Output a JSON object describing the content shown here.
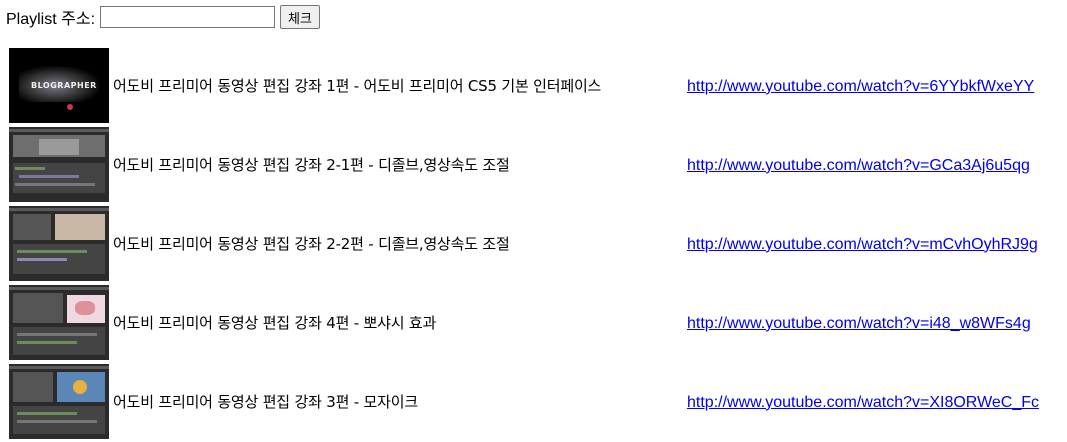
{
  "form": {
    "label": "Playlist 주소:",
    "input_value": "",
    "check_button": "체크"
  },
  "videos": [
    {
      "title": "어도비 프리미어 동영상 편집 강좌 1편 - 어도비 프리미어 CS5 기본 인터페이스",
      "url": "http://www.youtube.com/watch?v=6YYbkfWxeYY",
      "thumb_text": "BLOGRAPHER"
    },
    {
      "title": "어도비 프리미어 동영상 편집 강좌 2-1편 - 디졸브,영상속도 조절",
      "url": "http://www.youtube.com/watch?v=GCa3Aj6u5qg"
    },
    {
      "title": "어도비 프리미어 동영상 편집 강좌 2-2편 - 디졸브,영상속도 조절",
      "url": "http://www.youtube.com/watch?v=mCvhOyhRJ9g"
    },
    {
      "title": "어도비 프리미어 동영상 편집 강좌 4편 - 뽀샤시 효과",
      "url": "http://www.youtube.com/watch?v=i48_w8WFs4g"
    },
    {
      "title": "어도비 프리미어 동영상 편집 강좌 3편 - 모자이크",
      "url": "http://www.youtube.com/watch?v=XI8ORWeC_Fc"
    }
  ],
  "colors": {
    "link": "#0000ee",
    "thumb_background": "#2b2b2b"
  }
}
